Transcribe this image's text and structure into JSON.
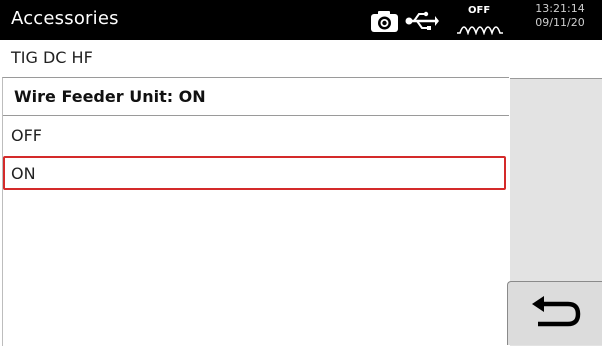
{
  "titlebar": {
    "title": "Accessories",
    "icons": [
      "camera-icon",
      "usb-icon",
      "hf-wave-icon"
    ],
    "hf_label": "OFF",
    "clock": {
      "time": "13:21:14",
      "date": "09/11/20"
    }
  },
  "mode": "TIG  DC  HF",
  "parameter": {
    "header": "Wire Feeder Unit: ON",
    "options": [
      {
        "label": "OFF",
        "selected": false
      },
      {
        "label": "ON",
        "selected": true
      }
    ]
  },
  "side_panel": {
    "back_icon": "return-arrow-icon"
  },
  "colors": {
    "titlebar_bg": "#000000",
    "selection_border": "#d42a2a",
    "side_panel_bg": "#e3e3e3"
  }
}
